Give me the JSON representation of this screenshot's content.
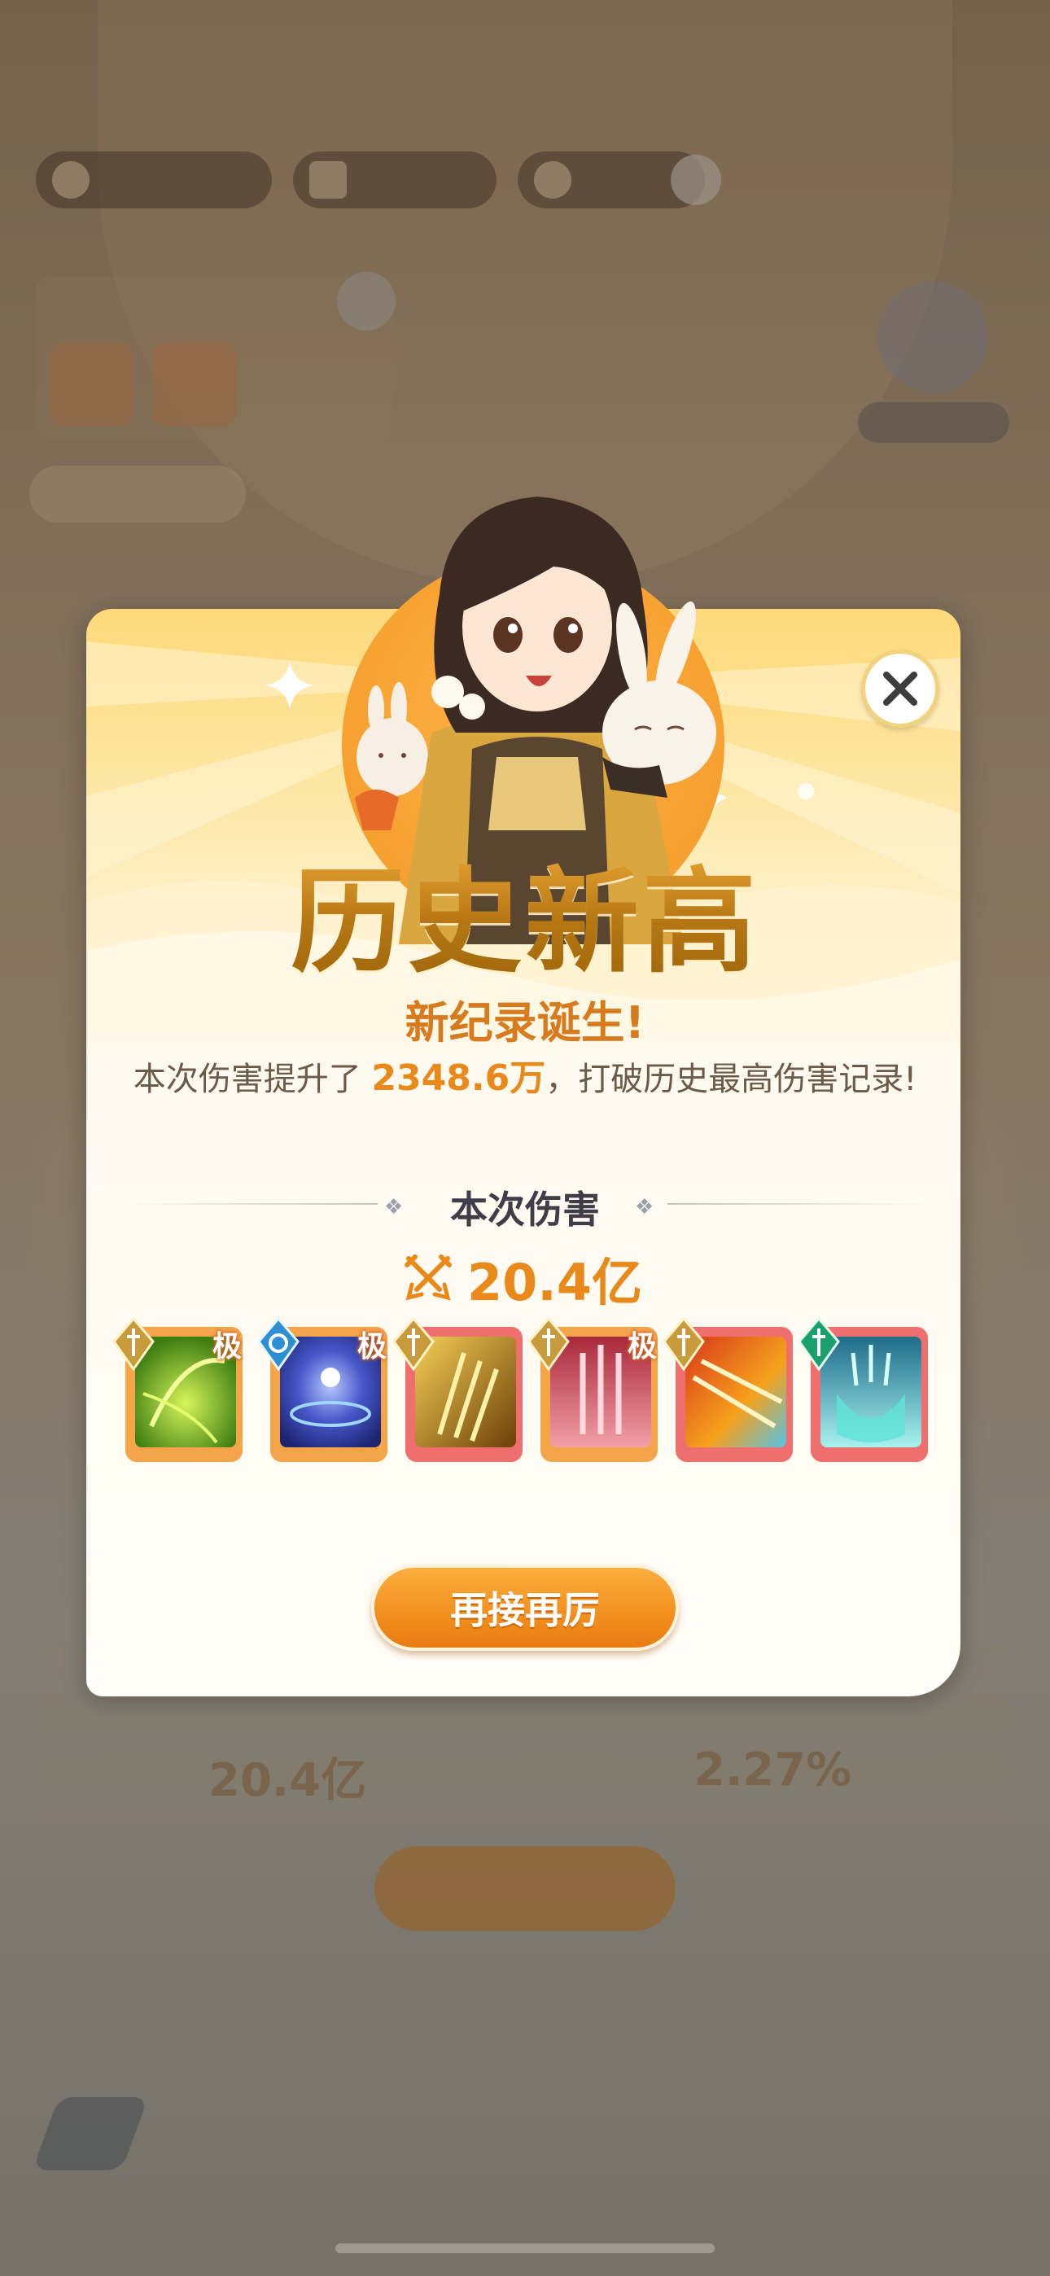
{
  "modal": {
    "headline": "历史新高",
    "subtitle": "新纪录诞生!",
    "desc_prefix": "本次伤害提升了",
    "desc_value": "2348.6万",
    "desc_suffix": "，打破历史最高伤害记录!",
    "section_label": "本次伤害",
    "damage_value": "20.4亿",
    "skills": [
      {
        "name": "green-vortex-skill",
        "frame": "orange",
        "badge": "sword-badge",
        "extreme": "极"
      },
      {
        "name": "blue-orb-skill",
        "frame": "orange",
        "badge": "wind-badge",
        "extreme": "极"
      },
      {
        "name": "golden-daggers-skill",
        "frame": "red",
        "badge": "sword-badge",
        "extreme": ""
      },
      {
        "name": "red-swords-skill",
        "frame": "orange",
        "badge": "sword-badge",
        "extreme": "极"
      },
      {
        "name": "fire-streak-skill",
        "frame": "red",
        "badge": "sword-badge",
        "extreme": ""
      },
      {
        "name": "teal-shield-skill",
        "frame": "red",
        "badge": "green-sword-badge",
        "extreme": ""
      }
    ],
    "retry_label": "再接再厉",
    "close_icon": "close-icon"
  },
  "background": {
    "ghost_damage": "20.4亿",
    "ghost_percent": "2.27%"
  },
  "colors": {
    "accent_orange": "#e8891a",
    "headline_gold": "#b67714",
    "text_dark": "#3f3d48"
  }
}
